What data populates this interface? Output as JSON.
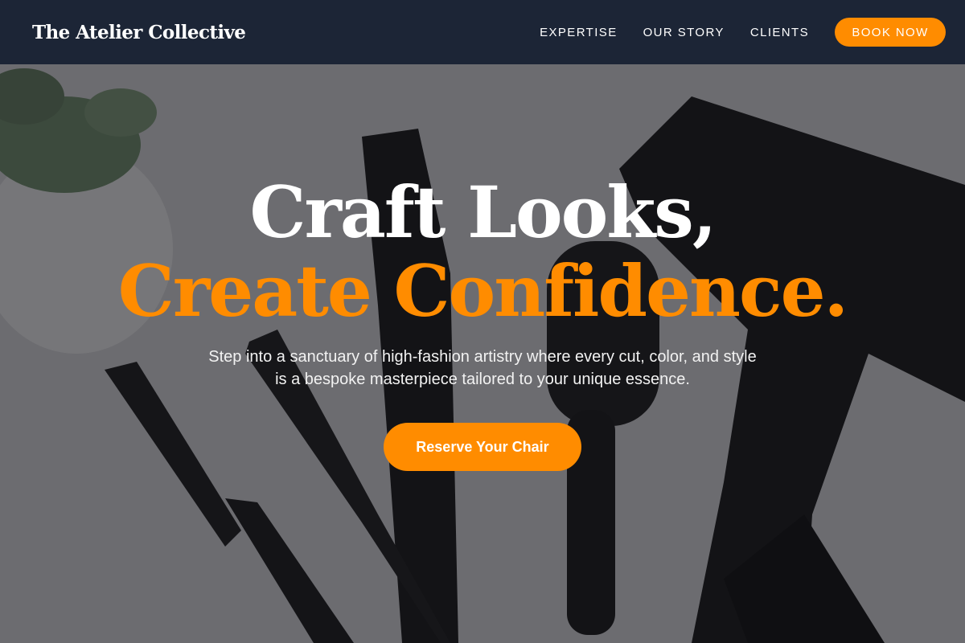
{
  "brand": {
    "name": "The Atelier Collective"
  },
  "nav": {
    "items": [
      {
        "label": "EXPERTISE"
      },
      {
        "label": "OUR STORY"
      },
      {
        "label": "CLIENTS"
      }
    ],
    "cta_label": "BOOK NOW"
  },
  "hero": {
    "headline_line1": "Craft Looks,",
    "headline_line2": "Create Confidence.",
    "subtext": "Step into a sanctuary of high-fashion artistry where every cut, color, and style is a bespoke masterpiece tailored to your unique essence.",
    "cta_label": "Reserve Your Chair",
    "background_image": "hair-tools-flatlay-photo"
  },
  "colors": {
    "nav_bg": "#1c2536",
    "accent": "#ff8c00",
    "text_light": "#ffffff"
  }
}
